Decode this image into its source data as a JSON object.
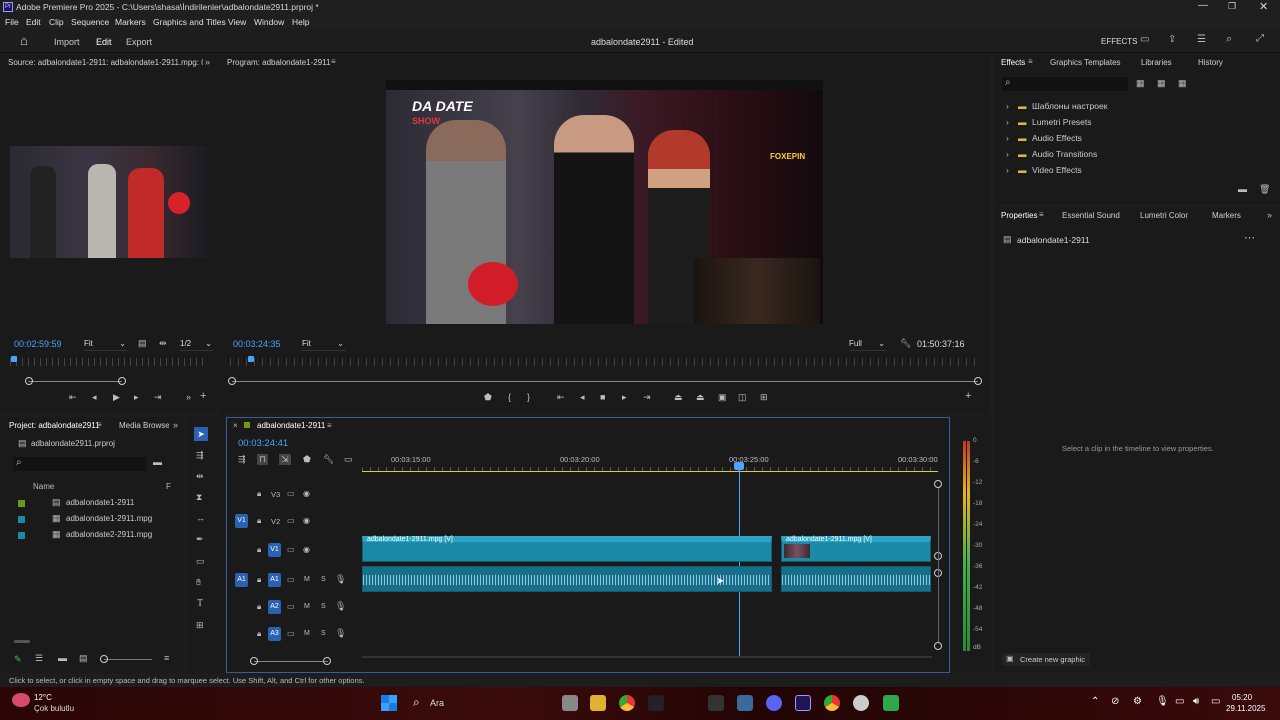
{
  "app": {
    "title": "Adobe Premiere Pro 2025 - C:\\Users\\shasa\\İndirilenler\\adbalondate2911.prproj *"
  },
  "menu": [
    "File",
    "Edit",
    "Clip",
    "Sequence",
    "Markers",
    "Graphics and Titles",
    "View",
    "Window",
    "Help"
  ],
  "nav": {
    "import": "Import",
    "edit": "Edit",
    "export": "Export",
    "project_title": "adbalondate2911 - Edited",
    "effects": "EFFECTS"
  },
  "source": {
    "tab": "Source: adbalondate1-2911: adbalondate1-2911.mpg: 00:02",
    "timecode": "00:02:59:59",
    "fit": "Fit",
    "res": "1/2"
  },
  "program": {
    "tab": "Program: adbalondate1-2911",
    "timecode": "00:03:24:35",
    "fit": "Fit",
    "quality": "Full",
    "duration": "01:50:37:16"
  },
  "video_overlay": {
    "show_line1": "DA DATE",
    "show_line2": "SHOW",
    "brand": "FOXEPIN"
  },
  "effects": {
    "tabs": [
      "Effects",
      "Graphics Templates",
      "Libraries",
      "History"
    ],
    "folders": [
      "Шаблоны настроек",
      "Lumetri Presets",
      "Audio Effects",
      "Audio Transitions",
      "Video Effects"
    ]
  },
  "properties": {
    "tabs": [
      "Properties",
      "Essential Sound",
      "Lumetri Color",
      "Markers"
    ],
    "clip_name": "adbalondate1-2911",
    "hint": "Select a clip in the timeline to view properties.",
    "create_graphic": "Create new graphic"
  },
  "project": {
    "tabs": [
      "Project: adbalondate2911",
      "Media Browser"
    ],
    "file": "adbalondate2911.prproj",
    "col_name": "Name",
    "col_f": "F",
    "items": [
      {
        "name": "adbalondate1-2911",
        "color": "#6a9a1a"
      },
      {
        "name": "adbalondate1-2911.mpg",
        "color": "#1a8aaa"
      },
      {
        "name": "adbalondate2-2911.mpg",
        "color": "#1a8aaa"
      }
    ]
  },
  "timeline": {
    "tab": "adbalondate1-2911",
    "timecode": "00:03:24:41",
    "ruler": [
      "00:03:15:00",
      "00:03:20:00",
      "00:03:25:00",
      "00:03:30:00"
    ],
    "tracks": {
      "v3": "V3",
      "v2": "V2",
      "v1": "V1",
      "a1": "A1",
      "a2": "A2",
      "a3": "A3"
    },
    "clip1": "adbalondate1-2911.mpg [V]",
    "clip2": "adbalondate1-2911.mpg [V]",
    "m": "M",
    "s": "S"
  },
  "meter_scale": [
    "0",
    "-6",
    "-12",
    "-18",
    "-24",
    "-30",
    "-36",
    "-42",
    "-48",
    "-54",
    "dB"
  ],
  "status": "Click to select, or click in empty space and drag to marquee select. Use Shift, Alt, and Ctrl for other options.",
  "taskbar": {
    "temp": "12°C",
    "weather": "Çok bulutlu",
    "search": "Ara",
    "time": "05:20",
    "date": "29.11.2025"
  }
}
